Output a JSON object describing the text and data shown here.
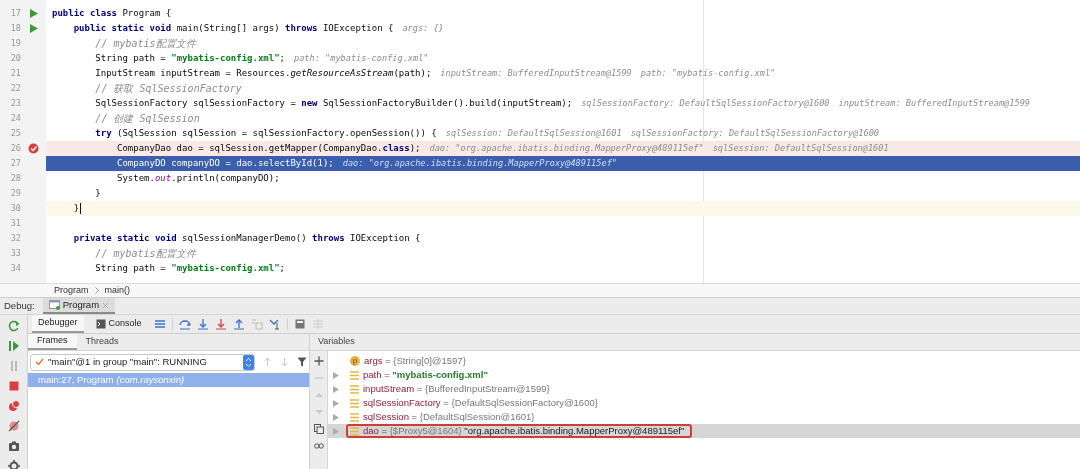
{
  "editor": {
    "lines": [
      {
        "number": "17",
        "run": true,
        "breakpoint": false,
        "current": false,
        "caret": false,
        "segments": [
          {
            "kind": "keyword",
            "text": "public class"
          },
          {
            "kind": "plain",
            "text": " Program {"
          }
        ]
      },
      {
        "number": "18",
        "run": true,
        "breakpoint": false,
        "current": false,
        "caret": false,
        "segments": [
          {
            "kind": "keyword",
            "text": "    public static void"
          },
          {
            "kind": "plain",
            "text": " main(String[] args) "
          },
          {
            "kind": "keyword",
            "text": "throws"
          },
          {
            "kind": "plain",
            "text": " IOException {"
          }
        ],
        "hints": [
          "args: {}"
        ]
      },
      {
        "number": "19",
        "run": false,
        "breakpoint": false,
        "current": false,
        "caret": false,
        "segments": [
          {
            "kind": "comment",
            "text": "        // mybatis配置文件"
          }
        ]
      },
      {
        "number": "20",
        "run": false,
        "breakpoint": false,
        "current": false,
        "caret": false,
        "segments": [
          {
            "kind": "plain",
            "text": "        String path = "
          },
          {
            "kind": "string",
            "text": "\"mybatis-config.xml\""
          },
          {
            "kind": "plain",
            "text": ";"
          }
        ],
        "hints": [
          "path: \"mybatis-config.xml\""
        ]
      },
      {
        "number": "21",
        "run": false,
        "breakpoint": false,
        "current": false,
        "caret": false,
        "segments": [
          {
            "kind": "plain",
            "text": "        InputStream inputStream = Resources."
          },
          {
            "kind": "method",
            "text": "getResourceAsStream"
          },
          {
            "kind": "plain",
            "text": "(path);"
          }
        ],
        "hints": [
          "inputStream: BufferedInputStream@1599",
          "path: \"mybatis-config.xml\""
        ]
      },
      {
        "number": "22",
        "run": false,
        "breakpoint": false,
        "current": false,
        "caret": false,
        "segments": [
          {
            "kind": "comment",
            "text": "        // 获取 SqlSessionFactory"
          }
        ]
      },
      {
        "number": "23",
        "run": false,
        "breakpoint": false,
        "current": false,
        "caret": false,
        "segments": [
          {
            "kind": "plain",
            "text": "        SqlSessionFactory sqlSessionFactory = "
          },
          {
            "kind": "keyword",
            "text": "new"
          },
          {
            "kind": "plain",
            "text": " SqlSessionFactoryBuilder().build(inputStream);"
          }
        ],
        "hints": [
          "sqlSessionFactory: DefaultSqlSessionFactory@1600",
          "inputStream: BufferedInputStream@1599"
        ]
      },
      {
        "number": "24",
        "run": false,
        "breakpoint": false,
        "current": false,
        "caret": false,
        "segments": [
          {
            "kind": "comment",
            "text": "        // 创建 SqlSession"
          }
        ]
      },
      {
        "number": "25",
        "run": false,
        "breakpoint": false,
        "current": false,
        "caret": false,
        "segments": [
          {
            "kind": "keyword",
            "text": "        try"
          },
          {
            "kind": "plain",
            "text": " (SqlSession sqlSession = sqlSessionFactory.openSession()) {"
          }
        ],
        "hints": [
          "sqlSession: DefaultSqlSession@1601",
          "sqlSessionFactory: DefaultSqlSessionFactory@1600"
        ]
      },
      {
        "number": "26",
        "run": false,
        "breakpoint": true,
        "current": false,
        "caret": false,
        "segments": [
          {
            "kind": "plain",
            "text": "            CompanyDao dao = sqlSession.getMapper(CompanyDao."
          },
          {
            "kind": "keyword",
            "text": "class"
          },
          {
            "kind": "plain",
            "text": ");"
          }
        ],
        "hints": [
          "dao: \"org.apache.ibatis.binding.MapperProxy@489115ef\"",
          "sqlSession: DefaultSqlSession@1601"
        ]
      },
      {
        "number": "27",
        "run": false,
        "breakpoint": false,
        "current": true,
        "caret": false,
        "segments": [
          {
            "kind": "plain",
            "text": "            CompanyDO companyDO = dao.selectById(1);"
          }
        ],
        "hints": [
          "dao: \"org.apache.ibatis.binding.MapperProxy@489115ef\""
        ]
      },
      {
        "number": "28",
        "run": false,
        "breakpoint": false,
        "current": false,
        "caret": false,
        "segments": [
          {
            "kind": "plain",
            "text": "            System."
          },
          {
            "kind": "field",
            "text": "out"
          },
          {
            "kind": "plain",
            "text": ".println(companyDO);"
          }
        ]
      },
      {
        "number": "29",
        "run": false,
        "breakpoint": false,
        "current": false,
        "caret": false,
        "segments": [
          {
            "kind": "plain",
            "text": "        }"
          }
        ]
      },
      {
        "number": "30",
        "run": false,
        "breakpoint": false,
        "current": false,
        "caret": true,
        "segments": [
          {
            "kind": "plain",
            "text": "    }"
          }
        ]
      },
      {
        "number": "31",
        "run": false,
        "breakpoint": false,
        "current": false,
        "caret": false
      },
      {
        "number": "32",
        "run": false,
        "breakpoint": false,
        "current": false,
        "caret": false,
        "segments": [
          {
            "kind": "keyword",
            "text": "    private static void"
          },
          {
            "kind": "plain",
            "text": " sqlSessionManagerDemo() "
          },
          {
            "kind": "keyword",
            "text": "throws"
          },
          {
            "kind": "plain",
            "text": " IOException {"
          }
        ]
      },
      {
        "number": "33",
        "run": false,
        "breakpoint": false,
        "current": false,
        "caret": false,
        "segments": [
          {
            "kind": "comment",
            "text": "        // mybatis配置文件"
          }
        ]
      },
      {
        "number": "34",
        "run": false,
        "breakpoint": false,
        "current": false,
        "caret": false,
        "segments": [
          {
            "kind": "plain",
            "text": "        String path = "
          },
          {
            "kind": "string",
            "text": "\"mybatis-config.xml\""
          },
          {
            "kind": "plain",
            "text": ";"
          }
        ]
      }
    ]
  },
  "breadcrumb": [
    "Program",
    "main()"
  ],
  "debug_bar": {
    "label": "Debug:",
    "sessions": [
      {
        "label": "Program",
        "selected": true
      }
    ]
  },
  "toolbar": {
    "tabs": [
      {
        "label": "Debugger",
        "selected": true
      },
      {
        "label": "Console",
        "selected": false
      }
    ]
  },
  "frames_panel": {
    "tabs": [
      {
        "label": "Frames",
        "selected": true
      },
      {
        "label": "Threads",
        "selected": false
      }
    ],
    "thread": "\"main\"@1 in group \"main\": RUNNING",
    "frames": [
      {
        "location": "main:27, Program",
        "package": "(com.raysonxin)",
        "selected": true
      }
    ]
  },
  "variables_panel": {
    "title": "Variables",
    "variables": [
      {
        "kind": "parameter",
        "badge": "p",
        "expandable": false,
        "name": "args",
        "operator": "=",
        "is_string": false,
        "value": "{String[0]@1597}",
        "selected": false,
        "outlined": false
      },
      {
        "kind": "local",
        "expandable": true,
        "name": "path",
        "operator": "=",
        "is_string": true,
        "value": "\"mybatis-config.xml\"",
        "selected": false,
        "outlined": false
      },
      {
        "kind": "local",
        "expandable": true,
        "name": "inputStream",
        "operator": "=",
        "is_string": false,
        "value": "{BufferedInputStream@1599}",
        "selected": false,
        "outlined": false
      },
      {
        "kind": "local",
        "expandable": true,
        "name": "sqlSessionFactory",
        "operator": "=",
        "is_string": false,
        "value": "{DefaultSqlSessionFactory@1600}",
        "selected": false,
        "outlined": false
      },
      {
        "kind": "local",
        "expandable": true,
        "name": "sqlSession",
        "operator": "=",
        "is_string": false,
        "value": "{DefaultSqlSession@1601}",
        "selected": false,
        "outlined": false
      },
      {
        "kind": "local",
        "expandable": true,
        "name": "dao",
        "operator": "=",
        "is_string": false,
        "value": "{$Proxy5@1604}",
        "description": "\"org.apache.ibatis.binding.MapperProxy@489115ef\"",
        "selected": true,
        "outlined": true
      }
    ]
  }
}
